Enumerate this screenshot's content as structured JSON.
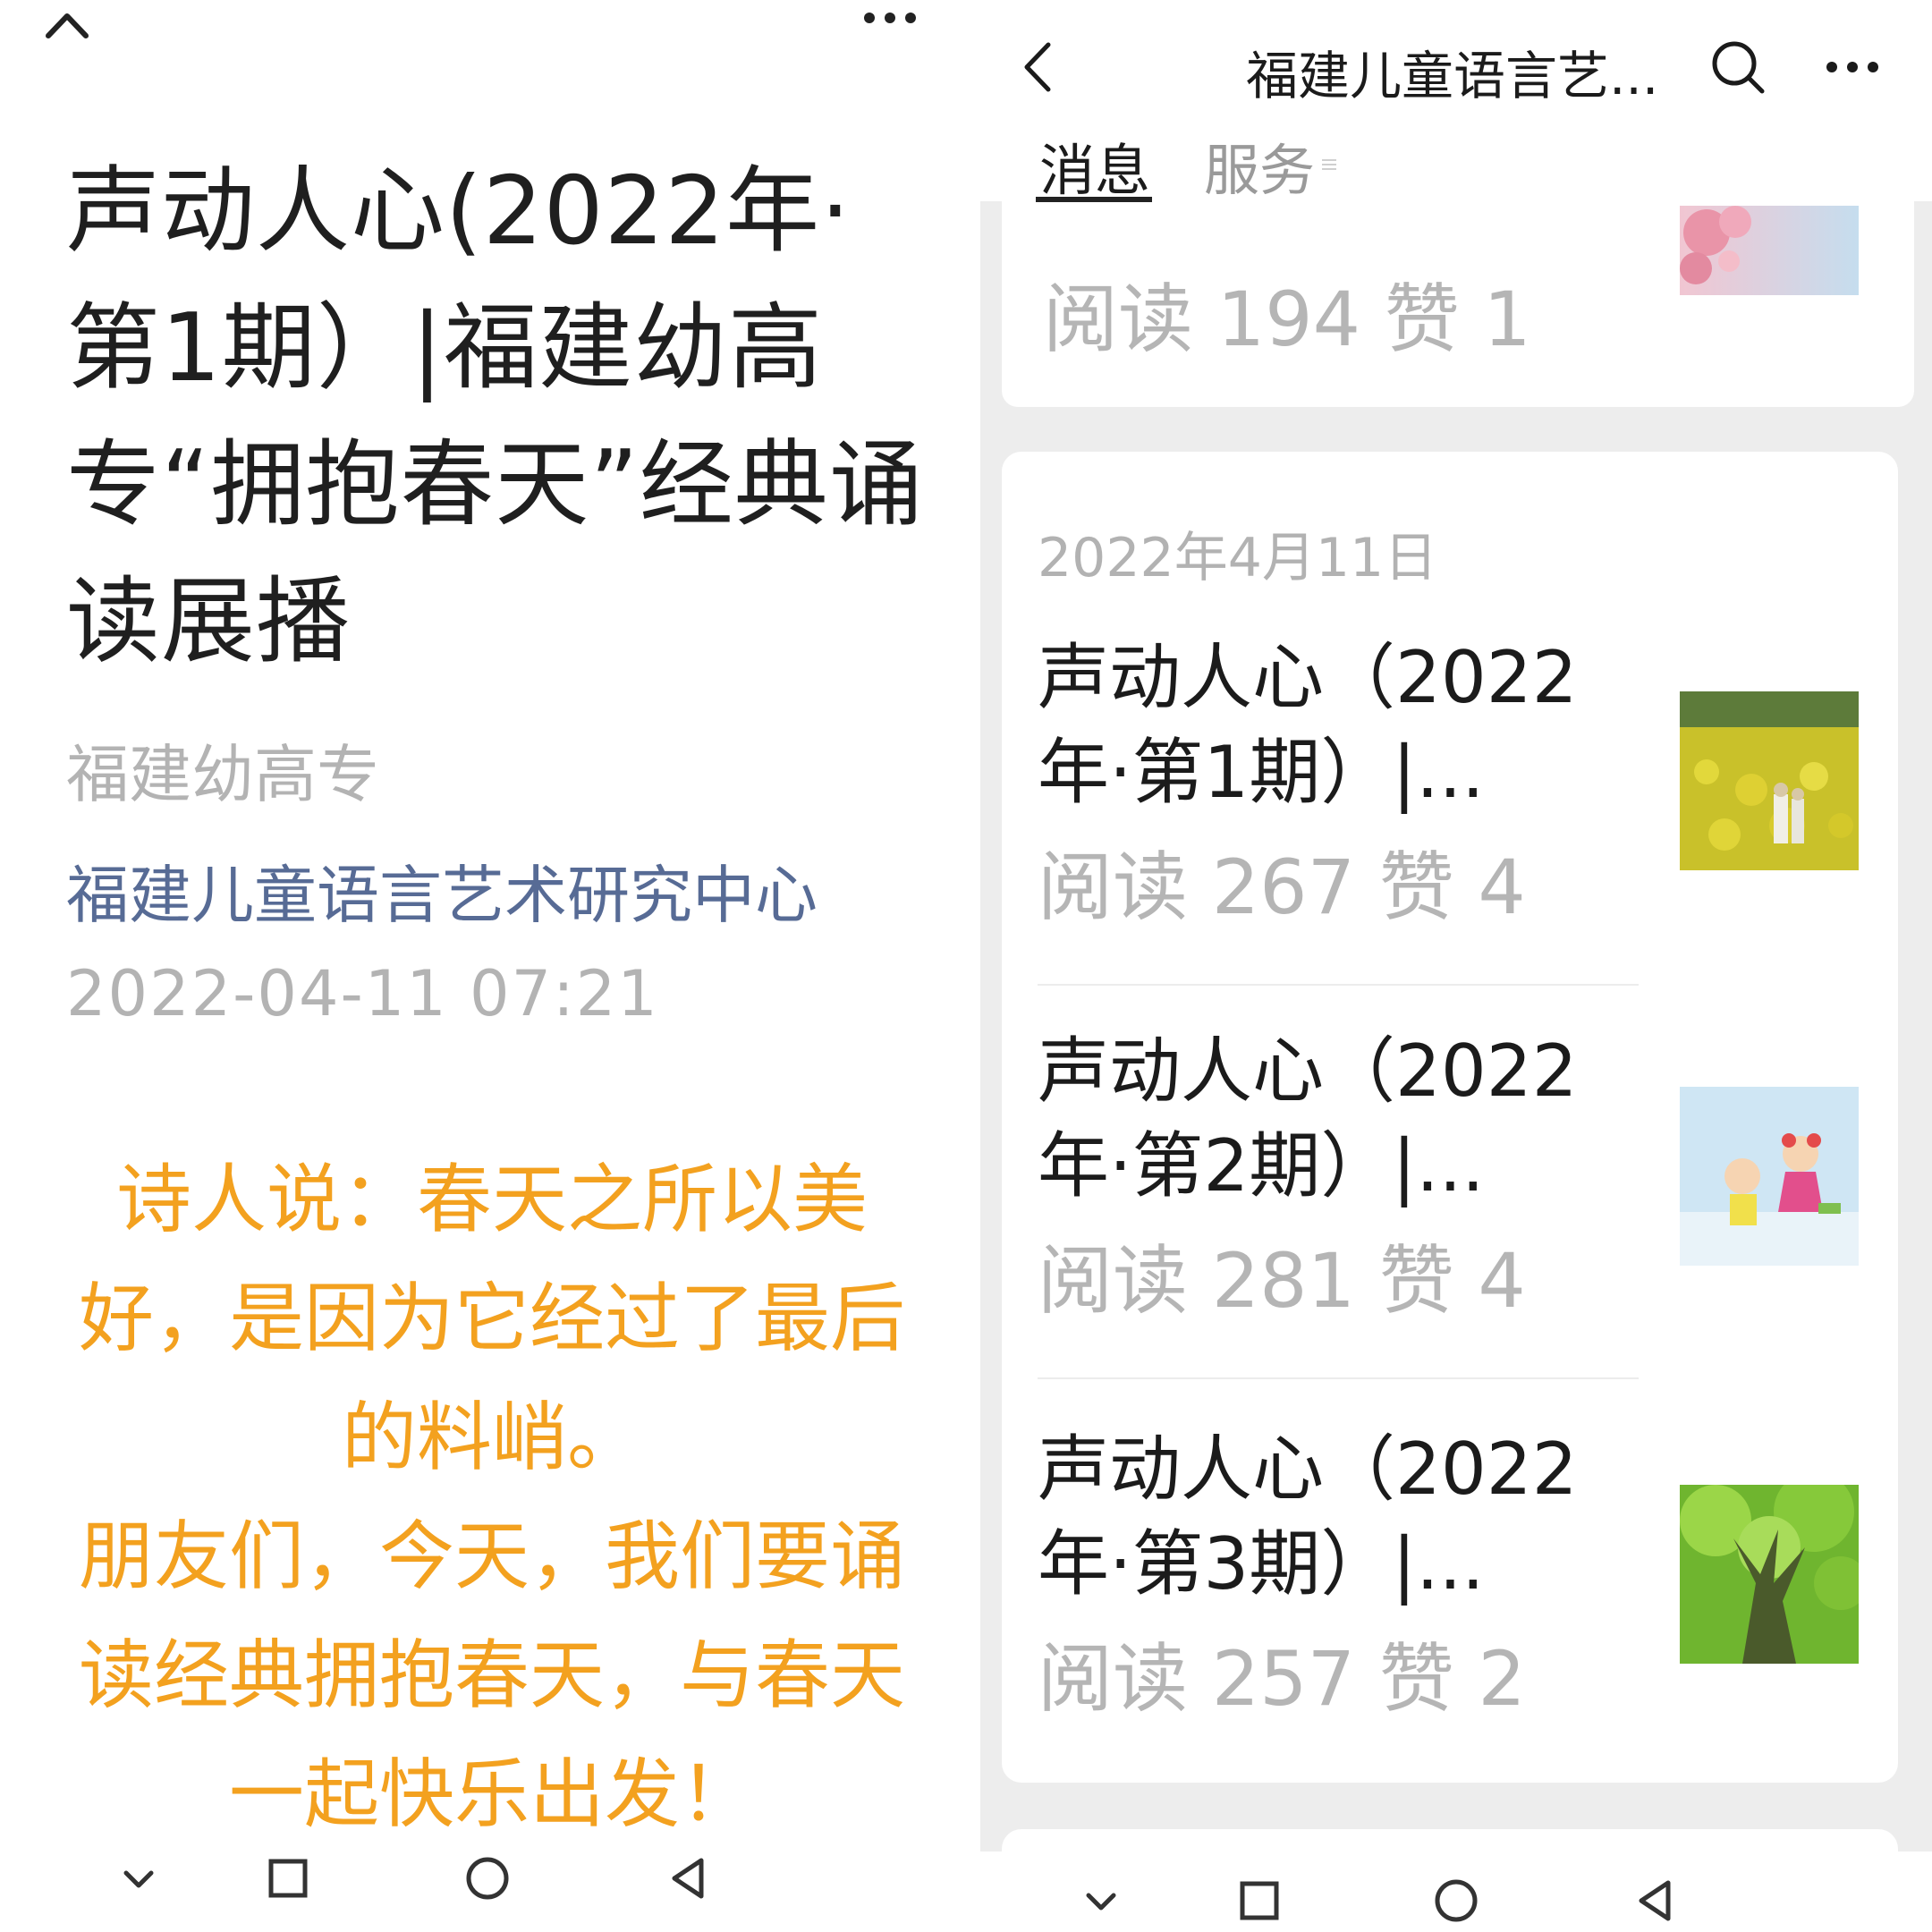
{
  "article": {
    "title": "声动人心(2022年·第1期）|福建幼高专“拥抱春天”经典诵读展播",
    "author": "福建幼高专",
    "account": "福建儿童语言艺术研究中心",
    "datetime": "2022-04-11 07:21",
    "poem": [
      "诗人说：春天之所以美好，是因为它经过了最后的料峭。",
      "朋友们，今天，我们要诵读经典拥抱春天，与春天一起快乐出发！"
    ],
    "poem_color": "#f3a11f"
  },
  "account_page": {
    "header_title": "福建儿童语言艺...",
    "tabs": [
      {
        "label": "消息",
        "active": true
      },
      {
        "label": "服务",
        "active": false
      }
    ],
    "partial_item": {
      "stats": "阅读 194  赞 1",
      "thumb_icon": "pink-blossom-thumbnail"
    },
    "date_group": "2022年4月11日",
    "items": [
      {
        "title": "声动人心（2022年·第1期）|...",
        "title_line1": "声动人心（2022",
        "title_line2": "年·第1期）|...",
        "stats": "阅读 267  赞 4",
        "thumb_icon": "rapeseed-field-thumbnail"
      },
      {
        "title": "声动人心（2022年·第2期）|...",
        "title_line1": "声动人心（2022",
        "title_line2": "年·第2期）|...",
        "stats": "阅读 281  赞 4",
        "thumb_icon": "cartoon-kids-thumbnail"
      },
      {
        "title": "声动人心（2022年·第3期）|...",
        "title_line1": "声动人心（2022",
        "title_line2": "年·第3期）|...",
        "stats": "阅读 257  赞 2",
        "thumb_icon": "green-tree-thumbnail"
      }
    ]
  },
  "nav": {
    "icons": [
      "hide-nav-icon",
      "recents-icon",
      "home-icon",
      "back-triangle-icon"
    ]
  },
  "colors": {
    "account_link": "#576b95",
    "muted_text": "#b3b3b3",
    "right_background": "#ededed"
  }
}
